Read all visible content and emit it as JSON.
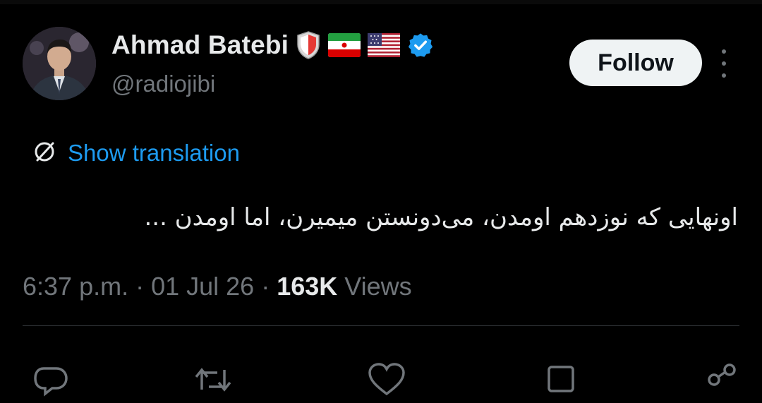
{
  "author": {
    "display_name": "Ahmad Batebi",
    "handle": "@radiojibi",
    "badges": [
      "shield-badge-icon",
      "iran-flag-icon",
      "us-flag-icon",
      "verified-badge-icon"
    ],
    "verified_color": "#1d9bf0"
  },
  "follow_button": {
    "label": "Follow"
  },
  "translation": {
    "label": "Show translation",
    "color": "#1d9bf0"
  },
  "tweet": {
    "text": "اونهایی که نوزدهم اومدن، می‌دونستن میمیرن، اما اومدن ..."
  },
  "meta": {
    "time": "6:37 p.m.",
    "separator": "·",
    "date": "01 Jul 26",
    "views_count": "163K",
    "views_label": "Views"
  },
  "actions": [
    {
      "name": "reply-icon"
    },
    {
      "name": "repost-icon"
    },
    {
      "name": "like-icon"
    },
    {
      "name": "bookmark-icon"
    },
    {
      "name": "share-icon"
    }
  ],
  "colors": {
    "background": "#000000",
    "text_primary": "#e7e9ea",
    "text_secondary": "#71767b",
    "accent": "#1d9bf0",
    "divider": "#2f3336"
  }
}
